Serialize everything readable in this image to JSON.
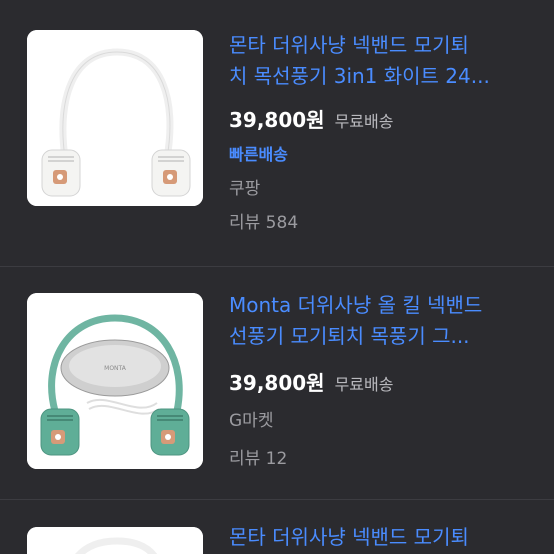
{
  "products": [
    {
      "title_line1": "몬타 더위사냥 넥밴드 모기퇴",
      "title_line2": "치 목선풍기 3in1 화이트 24...",
      "price": "39,800원",
      "shipping": "무료배송",
      "badge": "빠른배송",
      "shop": "쿠팡",
      "review": "리뷰 584",
      "color": "white"
    },
    {
      "title_line1": "Monta 더위사냥 올 킬 넥밴드",
      "title_line2": "선풍기 모기퇴치 목풍기 그...",
      "price": "39,800원",
      "shipping": "무료배송",
      "shop": "G마켓",
      "review": "리뷰 12",
      "case_logo": "MONTA",
      "color": "mint"
    },
    {
      "title_line1": "몬타 더위사냥 넥밴드 모기퇴"
    }
  ]
}
